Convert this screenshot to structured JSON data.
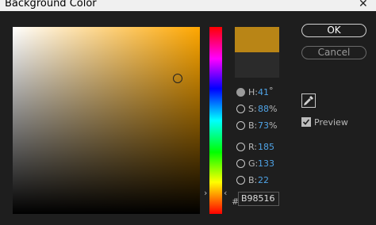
{
  "window": {
    "title": "Background Color",
    "close_glyph": "✕"
  },
  "color": {
    "hex": "B98516",
    "new_swatch": "#b98516",
    "old_swatch": "#2b2b2b"
  },
  "field": {
    "marker_saturation": 0.88,
    "marker_brightness": 0.73
  },
  "hue_slider": {
    "value_deg": 41
  },
  "channels": [
    {
      "key": "H",
      "label": "H:",
      "value": "41",
      "unit": "°",
      "selected": true
    },
    {
      "key": "S",
      "label": "S:",
      "value": "88",
      "unit": "%",
      "selected": false
    },
    {
      "key": "B",
      "label": "B:",
      "value": "73",
      "unit": "%",
      "selected": false
    },
    {
      "key": "R",
      "label": "R:",
      "value": "185",
      "unit": "",
      "selected": false
    },
    {
      "key": "G",
      "label": "G:",
      "value": "133",
      "unit": "",
      "selected": false
    },
    {
      "key": "Bl",
      "label": "B:",
      "value": "22",
      "unit": "",
      "selected": false
    }
  ],
  "hex_prefix": "#",
  "buttons": {
    "ok": "OK",
    "cancel": "Cancel"
  },
  "preview": {
    "label": "Preview",
    "checked": true
  },
  "icons": {
    "eyedropper": "eyedropper-icon",
    "checkmark": "checkmark-icon",
    "slider_arrow": "chevron"
  }
}
